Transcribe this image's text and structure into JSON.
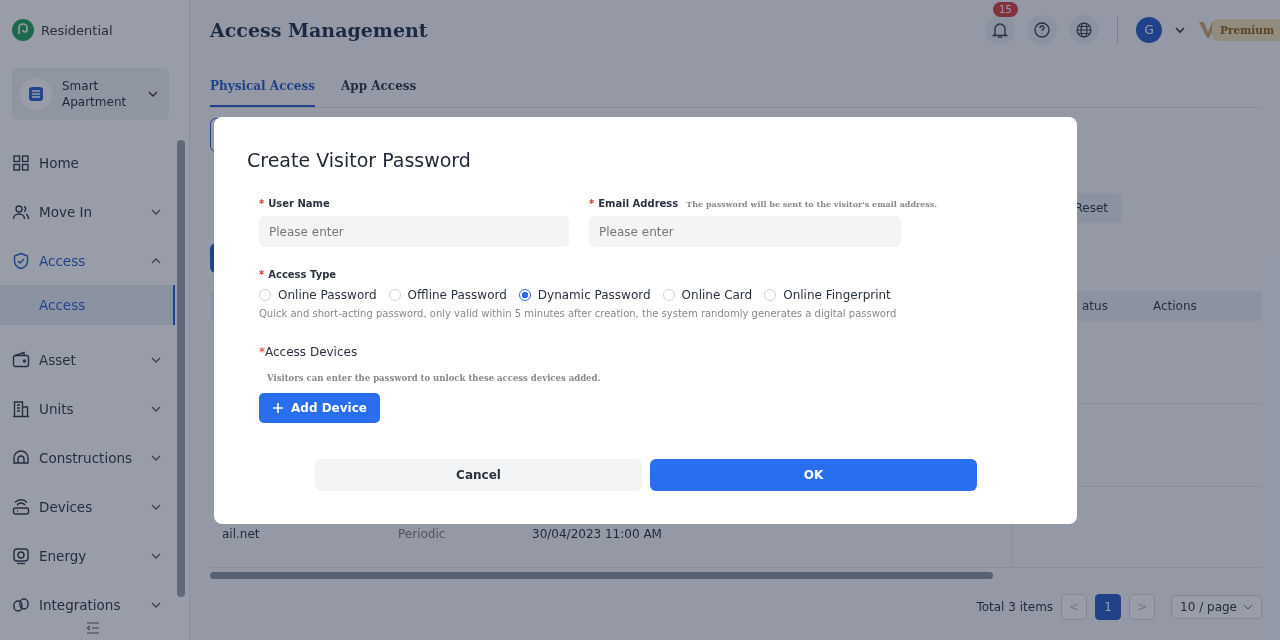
{
  "brand": {
    "name": "Residential"
  },
  "project": {
    "name": "Smart Apartment"
  },
  "sidebar": {
    "items": [
      {
        "label": "Home",
        "kind": "link",
        "selected": false
      },
      {
        "label": "Move In",
        "kind": "group",
        "expanded": false,
        "selected": false
      },
      {
        "label": "Access",
        "kind": "group",
        "expanded": true,
        "selected": true,
        "children": [
          {
            "label": "Access",
            "selected": true
          }
        ]
      },
      {
        "label": "Asset",
        "kind": "group",
        "expanded": false,
        "selected": false
      },
      {
        "label": "Units",
        "kind": "group",
        "expanded": false,
        "selected": false
      },
      {
        "label": "Constructions",
        "kind": "group",
        "expanded": false,
        "selected": false
      },
      {
        "label": "Devices",
        "kind": "group",
        "expanded": false,
        "selected": false
      },
      {
        "label": "Energy",
        "kind": "group",
        "expanded": false,
        "selected": false
      },
      {
        "label": "Integrations",
        "kind": "group",
        "expanded": false,
        "selected": false
      }
    ]
  },
  "header": {
    "title": "Access Management",
    "notifications": "15",
    "avatar": "G",
    "premium": "Premium"
  },
  "tabs": [
    {
      "label": "Physical Access",
      "selected": true
    },
    {
      "label": "App Access",
      "selected": false
    }
  ],
  "filter": {
    "reset": "Reset"
  },
  "table": {
    "columns": [
      "atus",
      "Actions"
    ],
    "rows": [
      {
        "email": "ail.net",
        "type": "Periodic",
        "time": "30/04/2023 11:00 AM"
      }
    ]
  },
  "pagination": {
    "total": "Total 3 items",
    "prev": "<",
    "pages": [
      {
        "label": "1",
        "selected": true
      }
    ],
    "next": ">",
    "size": "10 / page"
  },
  "dialog": {
    "title": "Create Visitor Password",
    "user_name": {
      "mark": "*",
      "label": "User Name",
      "placeholder": "Please enter"
    },
    "email": {
      "mark": "*",
      "label": "Email Address",
      "hint": "The password will be sent to the visitor's email address.",
      "placeholder": "Please enter"
    },
    "access_type": {
      "mark": "*",
      "label": "Access Type",
      "options": [
        {
          "label": "Online Password",
          "selected": false
        },
        {
          "label": "Offline Password",
          "selected": false
        },
        {
          "label": "Dynamic Password",
          "selected": true
        },
        {
          "label": "Online Card",
          "selected": false
        },
        {
          "label": "Online Fingerprint",
          "selected": false
        }
      ],
      "description": "Quick and short-acting password, only valid within 5 minutes after creation, the system randomly generates a digital password"
    },
    "devices": {
      "mark": "*",
      "label": "Access Devices",
      "hint": "Visitors can enter the password to unlock these access devices added.",
      "button": "Add Device"
    },
    "cancel": "Cancel",
    "ok": "OK"
  }
}
